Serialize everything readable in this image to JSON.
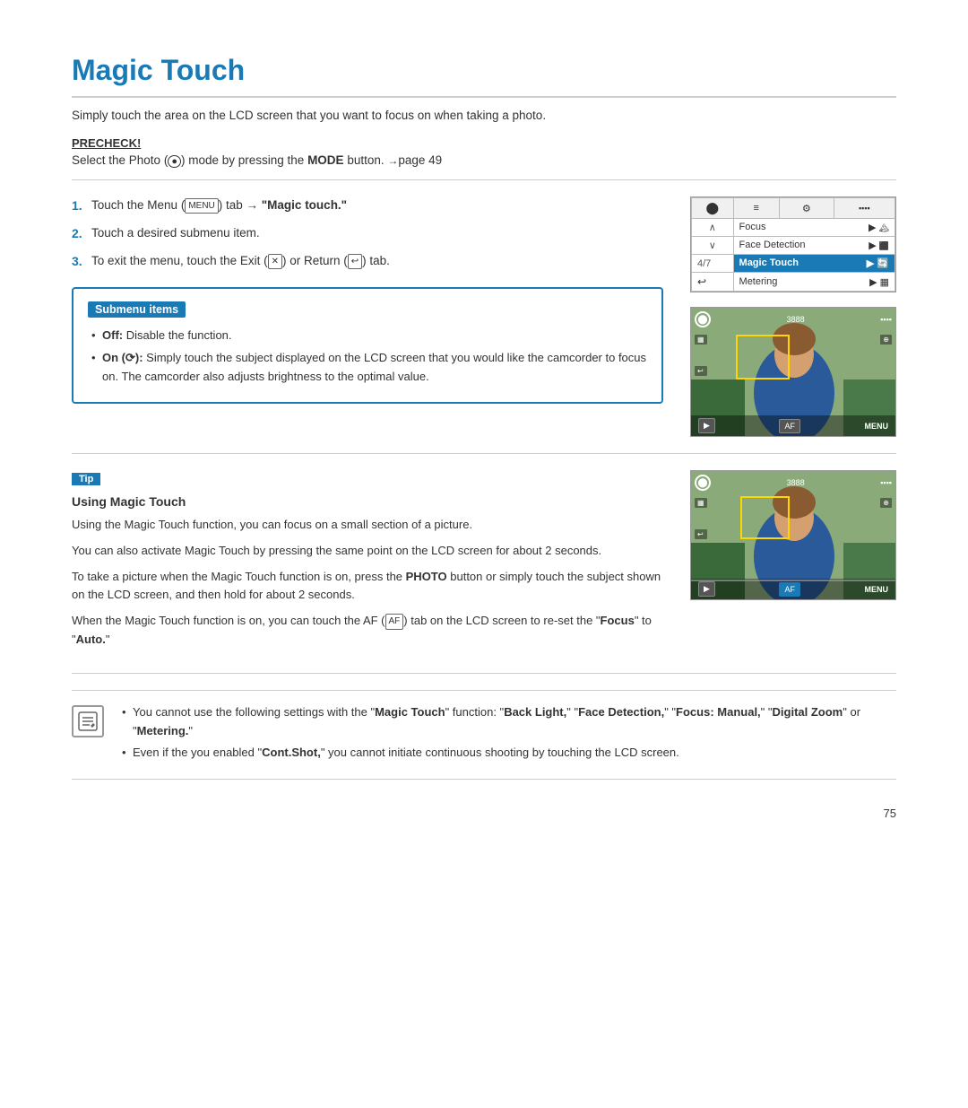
{
  "page": {
    "title": "Magic Touch",
    "subtitle": "Simply touch the area on the LCD screen that you want to focus on when taking a photo.",
    "precheck_label": "PRECHECK!",
    "precheck_text": "Select the Photo (",
    "precheck_icon": "●",
    "precheck_text2": ") mode by pressing the ",
    "precheck_bold": "MODE",
    "precheck_text3": " button. ",
    "precheck_arrow": "→",
    "precheck_page": "page 49",
    "steps": [
      {
        "num": "1.",
        "text_pre": "Touch the Menu (",
        "icon": "MENU",
        "text_mid": ") tab ",
        "arrow": "→",
        "text_bold": "\"Magic touch.\"",
        "text_post": ""
      },
      {
        "num": "2.",
        "text": "Touch a desired submenu item."
      },
      {
        "num": "3.",
        "text_pre": "To exit the menu, touch the Exit (",
        "icon1": "✕",
        "text_mid": ") or Return (",
        "icon2": "↩",
        "text_post": ") tab."
      }
    ],
    "submenu": {
      "title": "Submenu items",
      "items": [
        {
          "bold": "Off:",
          "text": " Disable the function."
        },
        {
          "bold": "On (⟳):",
          "text": " Simply touch the subject displayed on the LCD screen that you would like the camcorder to focus on. The camcorder also adjusts brightness to the optimal value."
        }
      ]
    },
    "camera_menu": {
      "rows": [
        {
          "label": "Focus",
          "arrow": "▶",
          "icon": ""
        },
        {
          "label": "Face Detection",
          "arrow": "▶",
          "icon": ""
        },
        {
          "label": "Magic Touch",
          "arrow": "▶",
          "icon": "",
          "selected": true
        },
        {
          "label": "Metering",
          "arrow": "▶",
          "icon": ""
        }
      ],
      "counter": "4/7"
    },
    "tip": {
      "label": "Tip",
      "heading": "Using Magic Touch",
      "paragraphs": [
        "Using the Magic Touch function, you can focus on a small section of a picture.",
        "You can also activate Magic Touch by pressing the same point on the LCD screen for about 2 seconds.",
        "To take a picture when the Magic Touch function is on, press the PHOTO button or simply touch the subject shown on the LCD screen, and then hold for about 2 seconds.",
        "When the Magic Touch function is on, you can touch the AF ( AF ) tab on the LCD screen to re-set the \"Focus\" to \"Auto.\""
      ]
    },
    "notes": {
      "items": [
        {
          "text_pre": "You cannot use the following settings with the \"",
          "bold1": "Magic Touch",
          "text_mid": "\" function: \"",
          "bold2": "Back Light,",
          "text_mid2": "\" \"",
          "bold3": "Face Detection,",
          "text_mid3": "\" \"",
          "bold4": "Focus: Manual,",
          "text_mid4": "\" \"",
          "bold5": "Digital Zoom",
          "text_post": "\" or \"",
          "bold6": "Metering.",
          "text_end": "\""
        },
        {
          "text_pre": "Even if the you enabled \"",
          "bold1": "Cont.Shot,",
          "text_post": "\" you cannot initiate continuous shooting by touching the LCD screen."
        }
      ]
    },
    "page_number": "75"
  }
}
